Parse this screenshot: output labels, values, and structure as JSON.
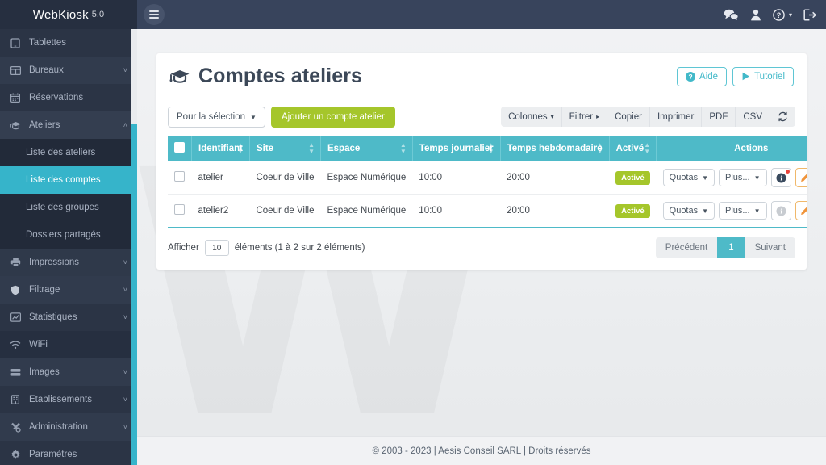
{
  "brand": {
    "name": "WebKiosk",
    "version": "5.0"
  },
  "sidebar": {
    "items": [
      {
        "label": "Tablettes",
        "icon": "tablet-icon",
        "caret": ""
      },
      {
        "label": "Bureaux",
        "icon": "grid-icon",
        "caret": "˅"
      },
      {
        "label": "Réservations",
        "icon": "calendar-icon",
        "caret": ""
      },
      {
        "label": "Ateliers",
        "icon": "graduation-cap-icon",
        "caret": "˄"
      },
      {
        "label": "Liste des ateliers",
        "icon": "",
        "caret": ""
      },
      {
        "label": "Liste des comptes",
        "icon": "",
        "caret": ""
      },
      {
        "label": "Liste des groupes",
        "icon": "",
        "caret": ""
      },
      {
        "label": "Dossiers partagés",
        "icon": "",
        "caret": ""
      },
      {
        "label": "Impressions",
        "icon": "printer-icon",
        "caret": "˅"
      },
      {
        "label": "Filtrage",
        "icon": "shield-icon",
        "caret": "˅"
      },
      {
        "label": "Statistiques",
        "icon": "chart-line-icon",
        "caret": "˅"
      },
      {
        "label": "WiFi",
        "icon": "wifi-icon",
        "caret": ""
      },
      {
        "label": "Images",
        "icon": "server-icon",
        "caret": "˅"
      },
      {
        "label": "Établissements",
        "icon": "building-icon",
        "caret": "˅"
      },
      {
        "label": "Administration",
        "icon": "tools-icon",
        "caret": "˅"
      },
      {
        "label": "Paramètres",
        "icon": "gear-icon",
        "caret": ""
      }
    ],
    "active_index": 5
  },
  "topbar": {
    "icons": [
      {
        "name": "comments-icon"
      },
      {
        "name": "user-icon"
      },
      {
        "name": "help-circle-icon"
      },
      {
        "name": "logout-icon"
      }
    ]
  },
  "page": {
    "title": "Comptes ateliers",
    "title_icon": "graduation-cap-icon",
    "help_button": "Aide",
    "tutorial_button": "Tutoriel"
  },
  "toolbar": {
    "selection_label": "Pour la sélection",
    "add_label": "Ajouter un compte atelier",
    "right_buttons": [
      {
        "label": "Colonnes",
        "caret": "▾"
      },
      {
        "label": "Filtrer",
        "caret": "▸"
      },
      {
        "label": "Copier",
        "caret": ""
      },
      {
        "label": "Imprimer",
        "caret": ""
      },
      {
        "label": "PDF",
        "caret": ""
      },
      {
        "label": "CSV",
        "caret": ""
      }
    ],
    "refresh_icon": "refresh-icon"
  },
  "table": {
    "columns": [
      {
        "label": "",
        "sortable": false,
        "align": "left"
      },
      {
        "label": "Identifiant",
        "sortable": true,
        "align": "left"
      },
      {
        "label": "Site",
        "sortable": true,
        "align": "left"
      },
      {
        "label": "Espace",
        "sortable": true,
        "align": "left"
      },
      {
        "label": "Temps journalier",
        "sortable": true,
        "align": "left"
      },
      {
        "label": "Temps hebdomadaire",
        "sortable": true,
        "align": "left"
      },
      {
        "label": "Activé",
        "sortable": true,
        "align": "left"
      },
      {
        "label": "Actions",
        "sortable": false,
        "align": "center"
      }
    ],
    "rows": [
      {
        "identifiant": "atelier",
        "site": "Coeur de Ville",
        "espace": "Espace Numérique",
        "temps_journalier": "10:00",
        "temps_hebdomadaire": "20:00",
        "active": "Activé",
        "actions": {
          "quotas": "Quotas",
          "plus": "Plus...",
          "info_icon": "info-circle-icon",
          "info_state": "alert",
          "edit_icon": "pencil-icon",
          "delete_icon": "trash-icon"
        }
      },
      {
        "identifiant": "atelier2",
        "site": "Coeur de Ville",
        "espace": "Espace Numérique",
        "temps_journalier": "10:00",
        "temps_hebdomadaire": "20:00",
        "active": "Activé",
        "actions": {
          "quotas": "Quotas",
          "plus": "Plus...",
          "info_icon": "info-circle-icon",
          "info_state": "muted",
          "edit_icon": "pencil-icon",
          "delete_icon": "trash-icon"
        }
      }
    ]
  },
  "footer_table": {
    "show_label": "Afficher",
    "page_size": "10",
    "elements_label": "éléments (1 à 2 sur 2 éléments)",
    "prev": "Précédent",
    "current_page": "1",
    "next": "Suivant"
  },
  "page_footer": {
    "text": "© 2003 - 2023 | Aesis Conseil SARL | Droits réservés"
  },
  "watermark": {
    "text": "W"
  },
  "colors": {
    "sidebar_bg": "#262f40",
    "topbar_bg": "#38445c",
    "accent_teal": "#4ebac8",
    "accent_green": "#a5c62b",
    "danger_red": "#e8443c",
    "edit_orange": "#f0943a"
  }
}
